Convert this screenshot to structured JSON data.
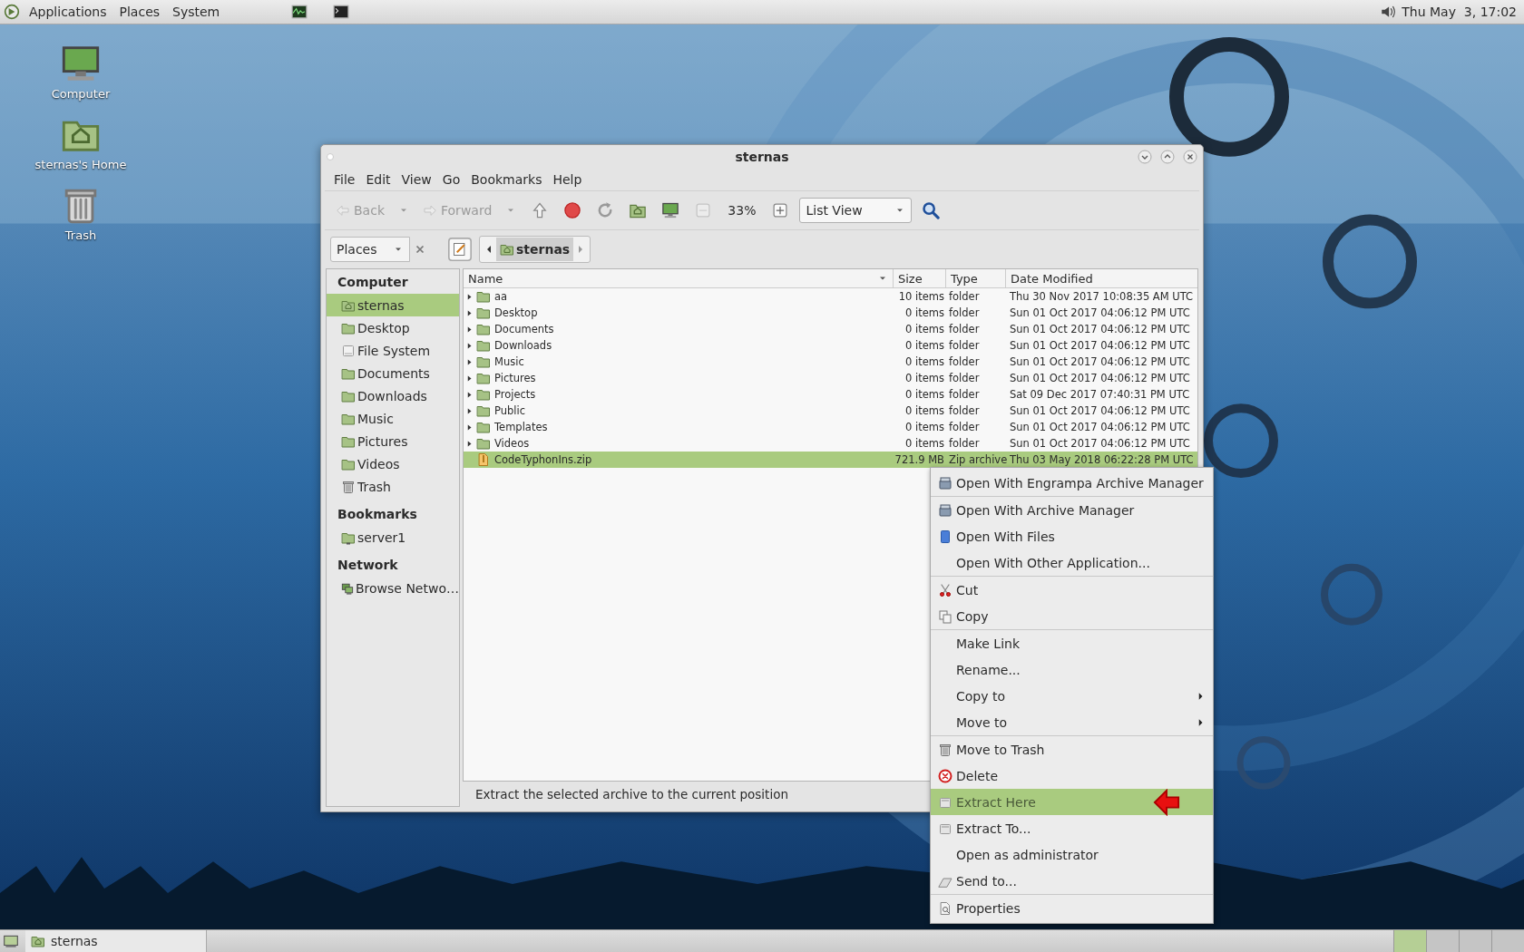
{
  "top_panel": {
    "menus": [
      "Applications",
      "Places",
      "System"
    ],
    "launchers": [
      {
        "kind": "monitor"
      },
      {
        "kind": "terminal"
      }
    ],
    "clock": "Thu May  3, 17:02"
  },
  "desktop_icons": [
    {
      "kind": "computer",
      "label": "Computer"
    },
    {
      "kind": "home",
      "label": "sternas's Home"
    },
    {
      "kind": "trash",
      "label": "Trash"
    }
  ],
  "window": {
    "title": "sternas",
    "menu": [
      "File",
      "Edit",
      "View",
      "Go",
      "Bookmarks",
      "Help"
    ],
    "toolbar": [
      {
        "kind": "back",
        "label": "Back",
        "disabled": true
      },
      {
        "kind": "dropdown",
        "disabled": true
      },
      {
        "kind": "forward",
        "label": "Forward",
        "disabled": true
      },
      {
        "kind": "dropdown",
        "disabled": true
      },
      {
        "kind": "up",
        "disabled": false
      },
      {
        "kind": "stop",
        "disabled": false
      },
      {
        "kind": "reload",
        "disabled": false
      },
      {
        "kind": "home",
        "disabled": false
      },
      {
        "kind": "computer",
        "disabled": false
      },
      {
        "kind": "zoom_out",
        "disabled": true
      },
      {
        "kind": "zoom_level",
        "label": "33%",
        "disabled": false
      },
      {
        "kind": "zoom_in",
        "disabled": false
      },
      {
        "kind": "view",
        "label": "List View",
        "disabled": false
      },
      {
        "kind": "search",
        "disabled": false
      }
    ],
    "location": {
      "pane": "Places",
      "path": "sternas"
    },
    "sidebar": [
      {
        "title": "Computer",
        "items": [
          {
            "kind": "home",
            "label": "sternas",
            "selected": true
          },
          {
            "kind": "folder",
            "label": "Desktop",
            "selected": false
          },
          {
            "kind": "drive",
            "label": "File System",
            "selected": false
          },
          {
            "kind": "folder",
            "label": "Documents",
            "selected": false
          },
          {
            "kind": "folder",
            "label": "Downloads",
            "selected": false
          },
          {
            "kind": "folder",
            "label": "Music",
            "selected": false
          },
          {
            "kind": "folder",
            "label": "Pictures",
            "selected": false
          },
          {
            "kind": "folder",
            "label": "Videos",
            "selected": false
          },
          {
            "kind": "trash",
            "label": "Trash",
            "selected": false
          }
        ]
      },
      {
        "title": "Bookmarks",
        "items": [
          {
            "kind": "server",
            "label": "server1",
            "selected": false
          }
        ]
      },
      {
        "title": "Network",
        "items": [
          {
            "kind": "network",
            "label": "Browse Netwo…",
            "selected": false
          }
        ]
      }
    ],
    "columns": [
      "Name",
      "Size",
      "Type",
      "Date Modified"
    ],
    "rows": [
      {
        "kind": "folder",
        "name": "aa",
        "size": "10 items",
        "type": "folder",
        "date": "Thu 30 Nov 2017 10:08:35 AM UTC",
        "selected": false
      },
      {
        "kind": "folder",
        "name": "Desktop",
        "size": "0 items",
        "type": "folder",
        "date": "Sun 01 Oct 2017 04:06:12 PM UTC",
        "selected": false
      },
      {
        "kind": "folder",
        "name": "Documents",
        "size": "0 items",
        "type": "folder",
        "date": "Sun 01 Oct 2017 04:06:12 PM UTC",
        "selected": false
      },
      {
        "kind": "folder",
        "name": "Downloads",
        "size": "0 items",
        "type": "folder",
        "date": "Sun 01 Oct 2017 04:06:12 PM UTC",
        "selected": false
      },
      {
        "kind": "folder",
        "name": "Music",
        "size": "0 items",
        "type": "folder",
        "date": "Sun 01 Oct 2017 04:06:12 PM UTC",
        "selected": false
      },
      {
        "kind": "folder",
        "name": "Pictures",
        "size": "0 items",
        "type": "folder",
        "date": "Sun 01 Oct 2017 04:06:12 PM UTC",
        "selected": false
      },
      {
        "kind": "folder",
        "name": "Projects",
        "size": "0 items",
        "type": "folder",
        "date": "Sat 09 Dec 2017 07:40:31 PM UTC",
        "selected": false
      },
      {
        "kind": "folder",
        "name": "Public",
        "size": "0 items",
        "type": "folder",
        "date": "Sun 01 Oct 2017 04:06:12 PM UTC",
        "selected": false
      },
      {
        "kind": "folder",
        "name": "Templates",
        "size": "0 items",
        "type": "folder",
        "date": "Sun 01 Oct 2017 04:06:12 PM UTC",
        "selected": false
      },
      {
        "kind": "folder",
        "name": "Videos",
        "size": "0 items",
        "type": "folder",
        "date": "Sun 01 Oct 2017 04:06:12 PM UTC",
        "selected": false
      },
      {
        "kind": "zip",
        "name": "CodeTyphonIns.zip",
        "size": "721.9 MB",
        "type": "Zip archive",
        "date": "Thu 03 May 2018 06:22:28 PM UTC",
        "selected": true
      }
    ],
    "status": "Extract the selected archive to the current position"
  },
  "context_menu": [
    {
      "kind": "archive",
      "label": "Open With Engrampa Archive Manager",
      "separator_before": false,
      "submenu": false,
      "selected": false
    },
    {
      "kind": "archive",
      "label": "Open With Archive Manager",
      "separator_before": true,
      "submenu": false,
      "selected": false
    },
    {
      "kind": "book",
      "label": "Open With Files",
      "separator_before": false,
      "submenu": false,
      "selected": false
    },
    {
      "kind": "plain",
      "label": "Open With Other Application...",
      "separator_before": false,
      "submenu": false,
      "selected": false
    },
    {
      "kind": "cut",
      "label": "Cut",
      "separator_before": true,
      "submenu": false,
      "selected": false
    },
    {
      "kind": "copy",
      "label": "Copy",
      "separator_before": false,
      "submenu": false,
      "selected": false
    },
    {
      "kind": "plain",
      "label": "Make Link",
      "separator_before": true,
      "submenu": false,
      "selected": false
    },
    {
      "kind": "plain",
      "label": "Rename...",
      "separator_before": false,
      "submenu": false,
      "selected": false
    },
    {
      "kind": "plain",
      "label": "Copy to",
      "separator_before": false,
      "submenu": true,
      "selected": false
    },
    {
      "kind": "plain",
      "label": "Move to",
      "separator_before": false,
      "submenu": true,
      "selected": false
    },
    {
      "kind": "trash",
      "label": "Move to Trash",
      "separator_before": true,
      "submenu": false,
      "selected": false
    },
    {
      "kind": "delete",
      "label": "Delete",
      "separator_before": false,
      "submenu": false,
      "selected": false
    },
    {
      "kind": "extract",
      "label": "Extract Here",
      "separator_before": false,
      "submenu": false,
      "selected": true,
      "annotated": true
    },
    {
      "kind": "extract",
      "label": "Extract To...",
      "separator_before": false,
      "submenu": false,
      "selected": false
    },
    {
      "kind": "plain",
      "label": "Open as administrator",
      "separator_before": false,
      "submenu": false,
      "selected": false
    },
    {
      "kind": "send",
      "label": "Send to...",
      "separator_before": false,
      "submenu": false,
      "selected": false
    },
    {
      "kind": "properties",
      "label": "Properties",
      "separator_before": true,
      "submenu": false,
      "selected": false
    }
  ],
  "taskbar": {
    "tasks": [
      {
        "label": "sternas",
        "selected": false
      }
    ],
    "workspaces": [
      {
        "selected": true
      },
      {
        "selected": false
      },
      {
        "selected": false
      },
      {
        "selected": false
      }
    ]
  }
}
